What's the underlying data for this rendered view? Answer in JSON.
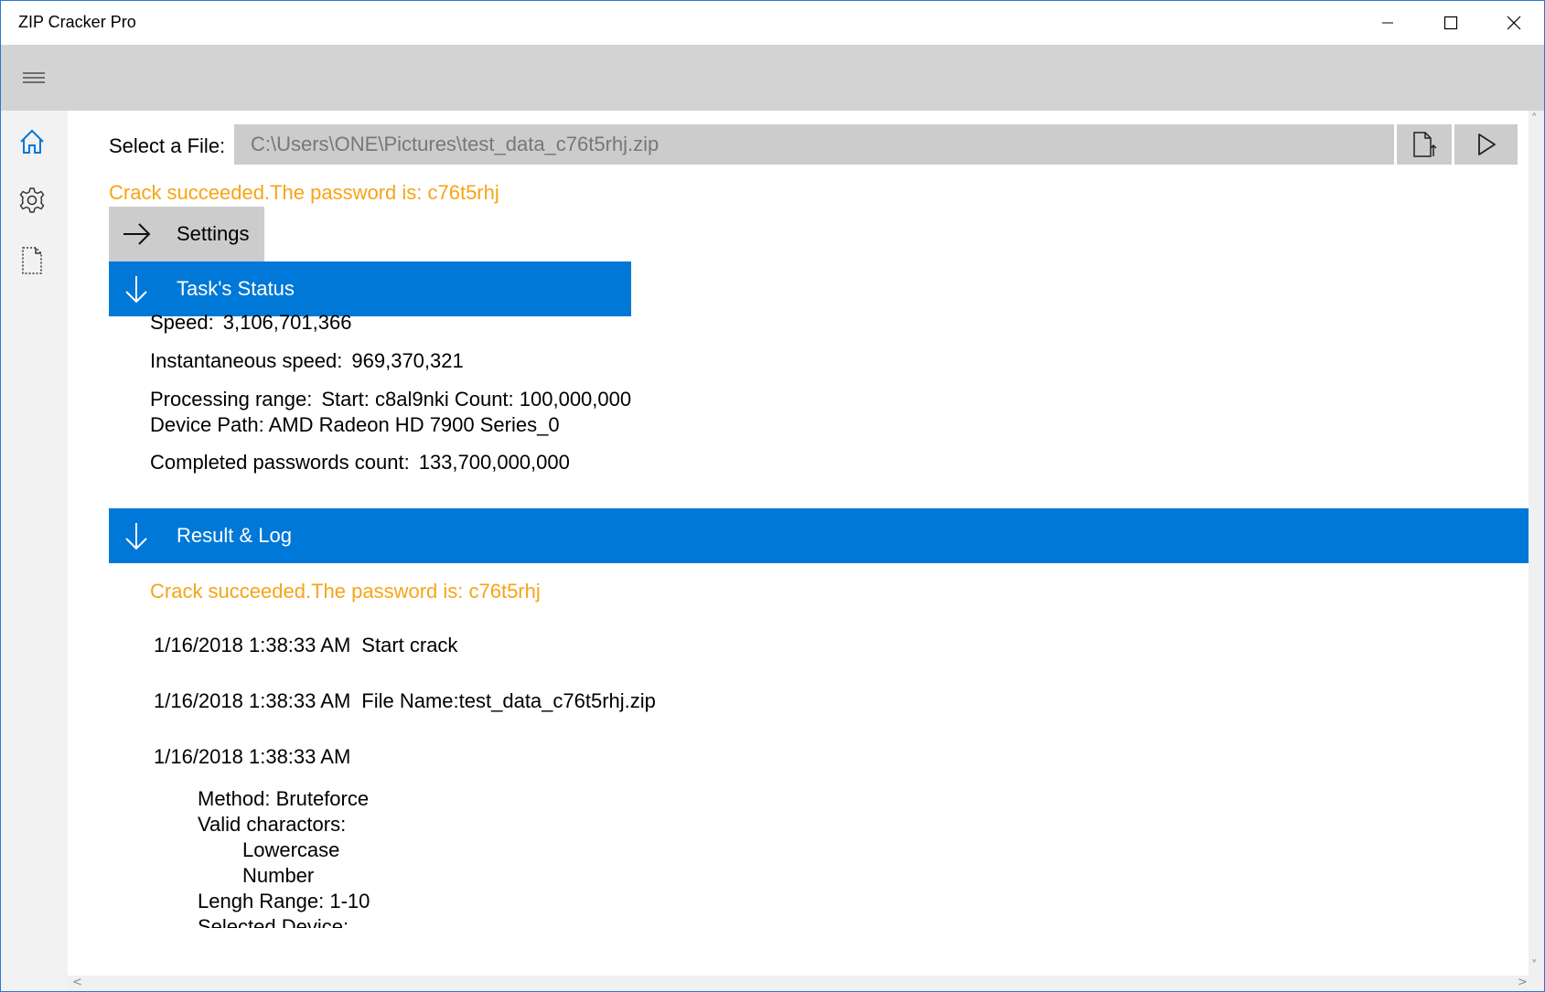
{
  "window": {
    "title": "ZIP Cracker Pro"
  },
  "nav": {
    "items": [
      {
        "icon": "home-icon",
        "active": true
      },
      {
        "icon": "gear-icon",
        "active": false
      },
      {
        "icon": "document-icon",
        "active": false
      }
    ]
  },
  "file": {
    "label": "Select a File:",
    "path": "C:\\Users\\ONE\\Pictures\\test_data_c76t5rhj.zip"
  },
  "result_top": "Crack succeeded.The password is: c76t5rhj",
  "sections": {
    "settings": "Settings",
    "status": "Task's Status",
    "result": "Result & Log"
  },
  "status": {
    "speed_label": "Speed:",
    "speed_value": "3,106,701,366",
    "inst_label": "Instantaneous speed:",
    "inst_value": "969,370,321",
    "range_label": "Processing range:",
    "range_value": "Start: c8al9nki Count: 100,000,000",
    "device_path": "Device Path: AMD Radeon HD 7900 Series_0",
    "completed_label": "Completed passwords count:",
    "completed_value": "133,700,000,000"
  },
  "log": {
    "success": "Crack succeeded.The password is: c76t5rhj",
    "entries": [
      {
        "time": "1/16/2018 1:38:33 AM",
        "msg": "Start crack"
      },
      {
        "time": "1/16/2018 1:38:33 AM",
        "msg": "File Name:test_data_c76t5rhj.zip"
      },
      {
        "time": "1/16/2018 1:38:33 AM",
        "msg": ""
      }
    ],
    "details": {
      "method": "Method: Bruteforce",
      "valid": "Valid charactors:",
      "lower": "Lowercase",
      "number": "Number",
      "length": "Lengh Range: 1-10",
      "device": "Selected Device:"
    }
  },
  "colors": {
    "accent": "#0078d7",
    "success": "#f7a416",
    "appbar": "#d3d3d3"
  }
}
